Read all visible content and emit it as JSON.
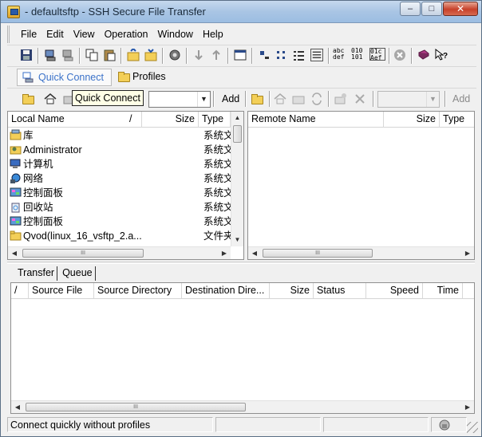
{
  "window": {
    "title": "- defaultsftp - SSH Secure File Transfer",
    "minimize_glyph": "–",
    "maximize_glyph": "□",
    "close_glyph": "✕"
  },
  "menu": [
    "File",
    "Edit",
    "View",
    "Operation",
    "Window",
    "Help"
  ],
  "toolbar": {
    "icons": [
      "save-icon",
      "connect-icon",
      "disconnect-icon",
      "copy-icon",
      "paste-icon",
      "upload-folder-icon",
      "download-folder-icon",
      "settings-icon",
      "download-arrow-icon",
      "upload-arrow-icon",
      "terminal-window-icon",
      "large-icons-icon",
      "small-icons-icon",
      "list-view-icon",
      "details-view-icon",
      "ascii-mode-icon",
      "binary-mode-icon",
      "auto-mode-icon",
      "stop-icon",
      "help-book-icon",
      "context-help-icon"
    ],
    "ascii_label": "abc def",
    "binary_label": "010 101",
    "auto_label": "01c Aef"
  },
  "quickbar": {
    "quick_connect_label": "Quick Connect",
    "profiles_label": "Profiles",
    "tooltip": "Quick Connect",
    "add_local": "Add",
    "add_remote": "Add"
  },
  "local_pane": {
    "columns": [
      "Local Name",
      "/",
      "Size",
      "Type"
    ],
    "rows": [
      {
        "name": "库",
        "type": "系统文件夹",
        "icon": "library-icon"
      },
      {
        "name": "Administrator",
        "type": "系统文件夹",
        "icon": "user-folder-icon"
      },
      {
        "name": "计算机",
        "type": "系统文件夹",
        "icon": "computer-icon"
      },
      {
        "name": "网络",
        "type": "系统文件夹",
        "icon": "network-icon"
      },
      {
        "name": "控制面板",
        "type": "系统文件夹",
        "icon": "control-panel-icon"
      },
      {
        "name": "回收站",
        "type": "系统文件夹",
        "icon": "recycle-bin-icon"
      },
      {
        "name": "控制面板",
        "type": "系统文件夹",
        "icon": "control-panel-icon"
      },
      {
        "name": "Qvod(linux_16_vsftp_2.a...",
        "type": "文件夹",
        "icon": "folder-icon"
      }
    ],
    "hscroll_grip": "III"
  },
  "remote_pane": {
    "columns": [
      "Remote Name",
      "Size",
      "Type"
    ],
    "hscroll_grip": "III"
  },
  "transfer": {
    "tabs": [
      "Transfer",
      "Queue"
    ],
    "columns": [
      "/",
      "Source File",
      "Source Directory",
      "Destination Dire...",
      "Size",
      "Status",
      "Speed",
      "Time"
    ],
    "hscroll_grip": "III"
  },
  "status": {
    "message": "Connect quickly without profiles"
  },
  "colors": {
    "accent": "#3b72c9",
    "close": "#c7412a"
  }
}
